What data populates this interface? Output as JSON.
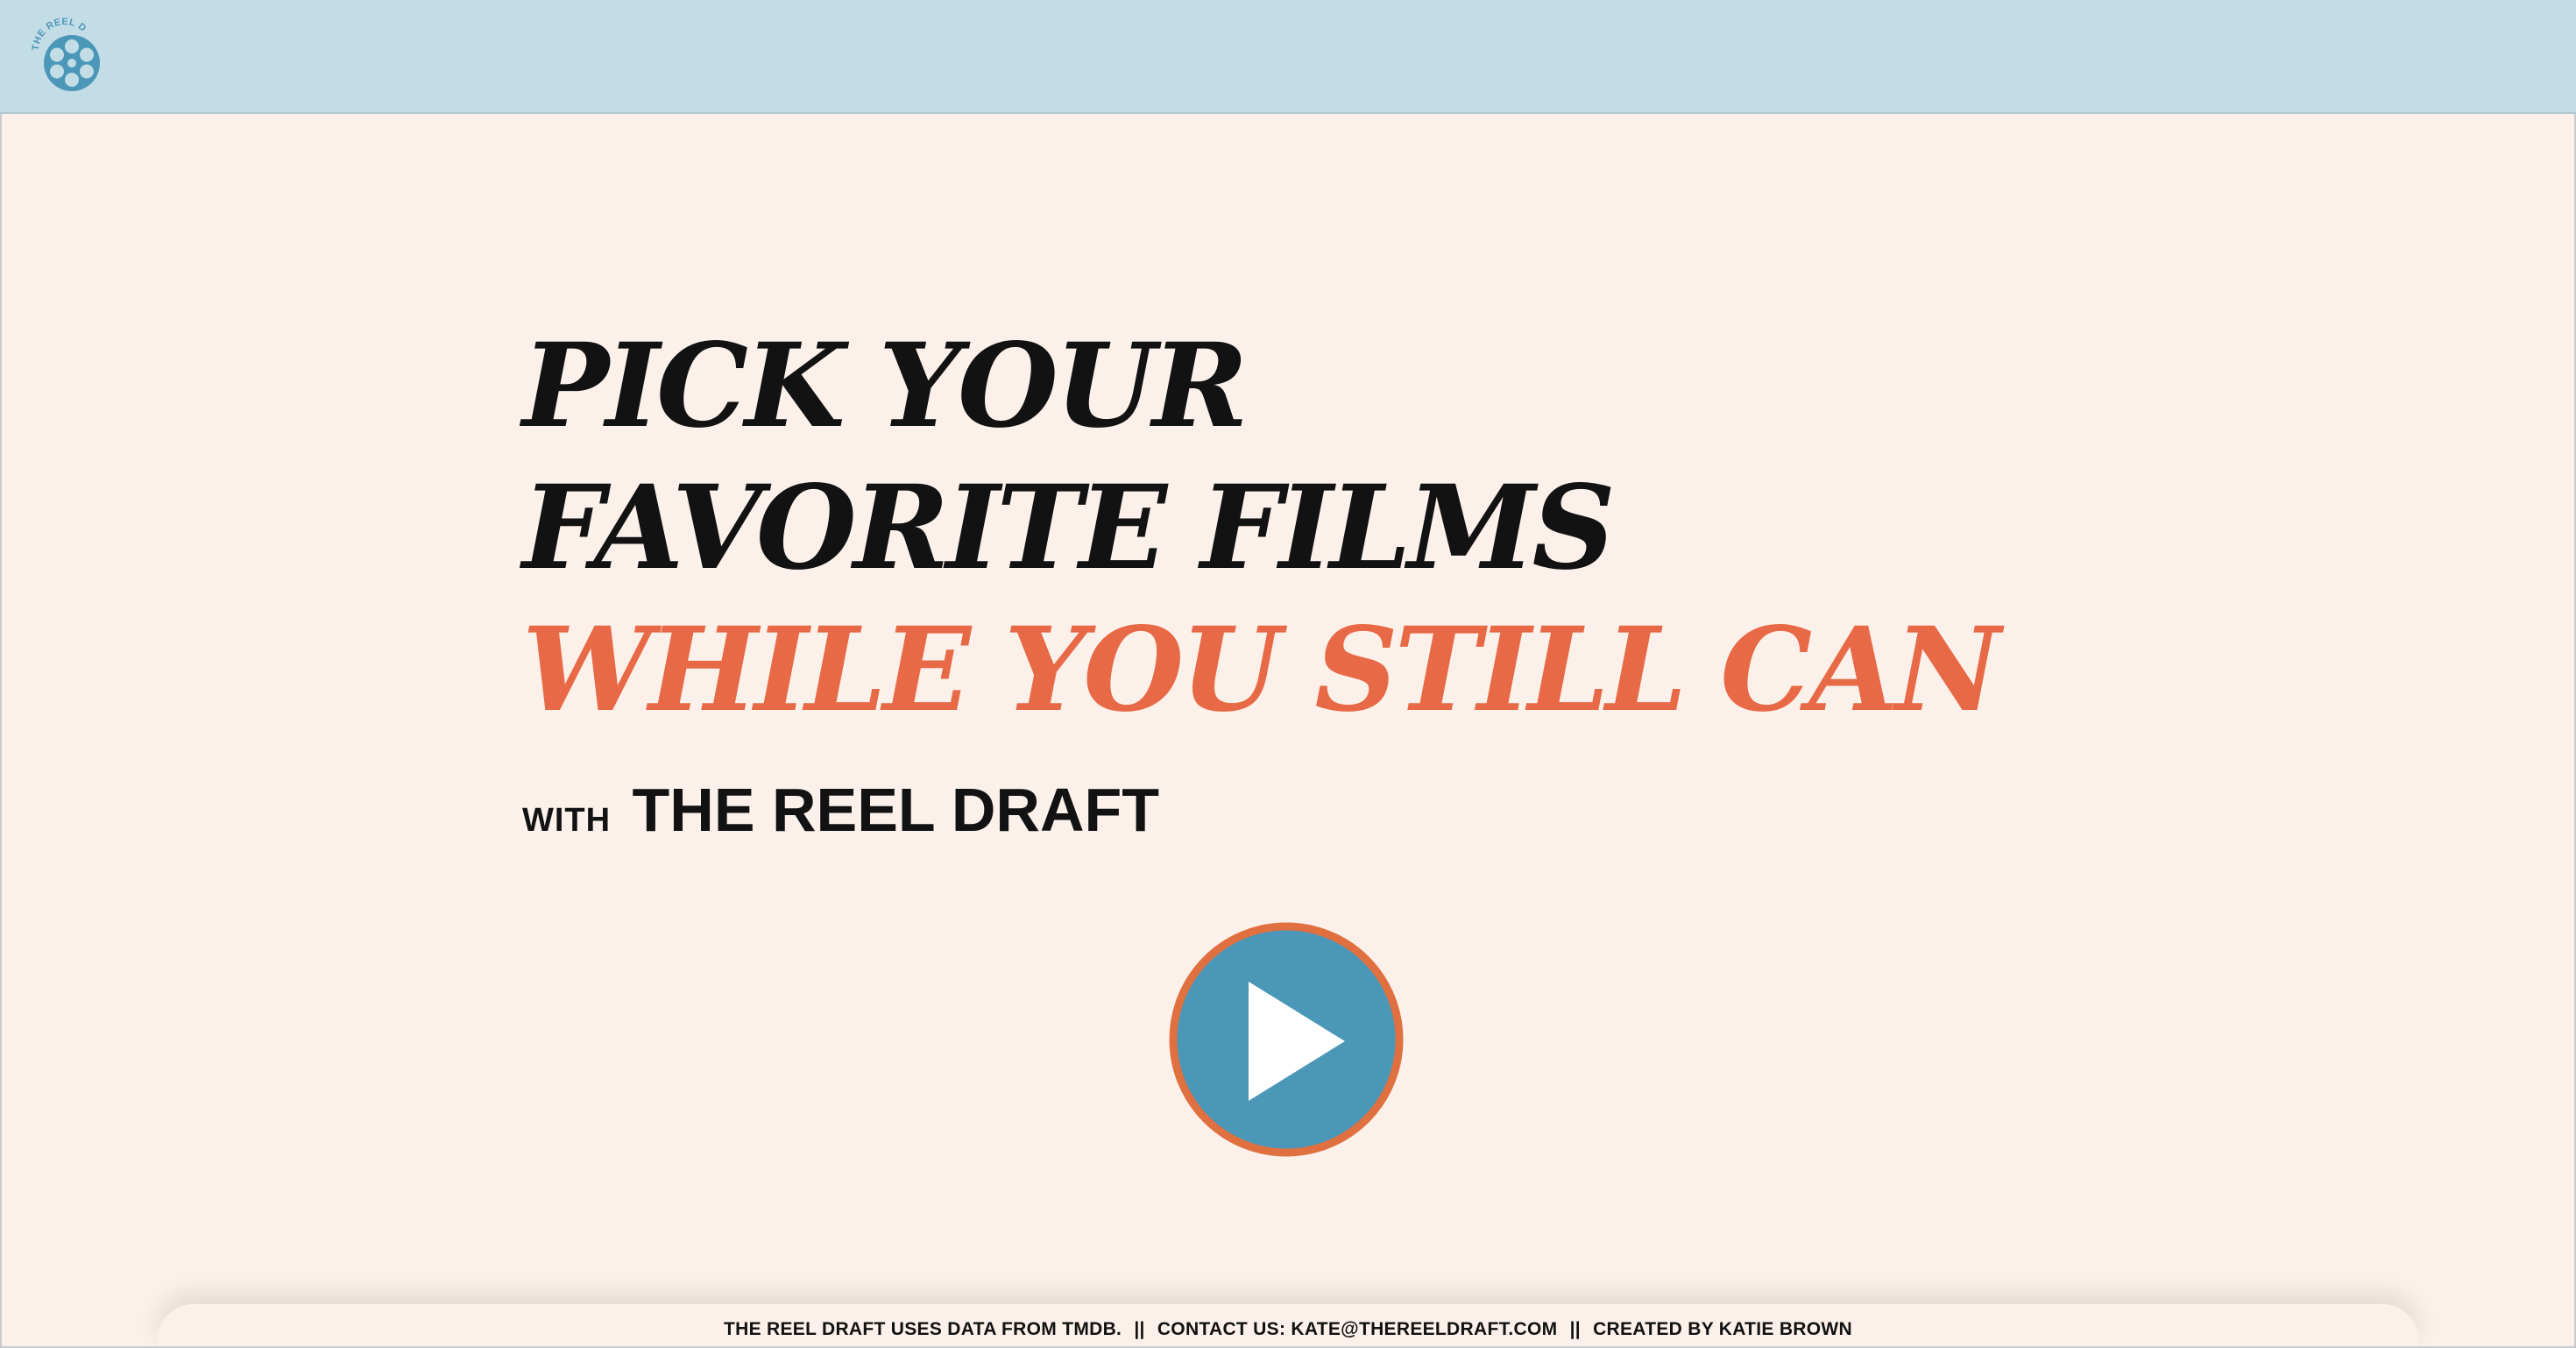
{
  "header": {
    "logo_text": "THE REEL DRAFT",
    "logo_icon": "film-reel-icon"
  },
  "hero": {
    "line1": "PICK YOUR",
    "line2": "FAVORITE FILMS",
    "line3": "WHILE YOU STILL CAN",
    "with_label": "WITH",
    "brand": "THE REEL DRAFT"
  },
  "play_button": {
    "icon": "play-icon"
  },
  "footer": {
    "data_credit": "THE REEL DRAFT USES DATA FROM TMDB.",
    "separator": "||",
    "contact": "CONTACT US: KATE@THEREELDRAFT.COM",
    "creator": "CREATED BY KATIE BROWN"
  },
  "colors": {
    "header_background": "#c3dde6",
    "page_background": "#fcf1ea",
    "accent_orange": "#e86946",
    "play_blue": "#4b97b8",
    "text_dark": "#121212"
  }
}
